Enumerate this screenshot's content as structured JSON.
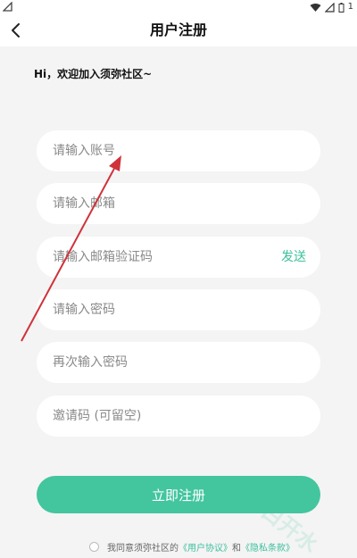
{
  "status_bar": {
    "battery_number": "1"
  },
  "header": {
    "title": "用户注册"
  },
  "welcome": "Hi，欢迎加入须弥社区~",
  "form": {
    "account_placeholder": "请输入账号",
    "email_placeholder": "请输入邮箱",
    "email_code_placeholder": "请输入邮箱验证码",
    "send_label": "发送",
    "password_placeholder": "请输入密码",
    "password_confirm_placeholder": "再次输入密码",
    "invite_placeholder": "邀请码 (可留空)"
  },
  "submit_label": "立即注册",
  "agreement": {
    "prefix": "我同意须弥社区的",
    "user_agreement": "《用户协议》",
    "and": "和",
    "privacy_policy": "《隐私条款》",
    "checked": false
  },
  "watermark": "白开水",
  "colors": {
    "accent": "#43c59e",
    "link": "#3cc09c",
    "background": "#f4f4f4",
    "annotation_arrow": "#d0323b"
  },
  "icons": [
    "back-arrow-icon",
    "wifi-icon",
    "battery-icon",
    "sim-icon"
  ]
}
